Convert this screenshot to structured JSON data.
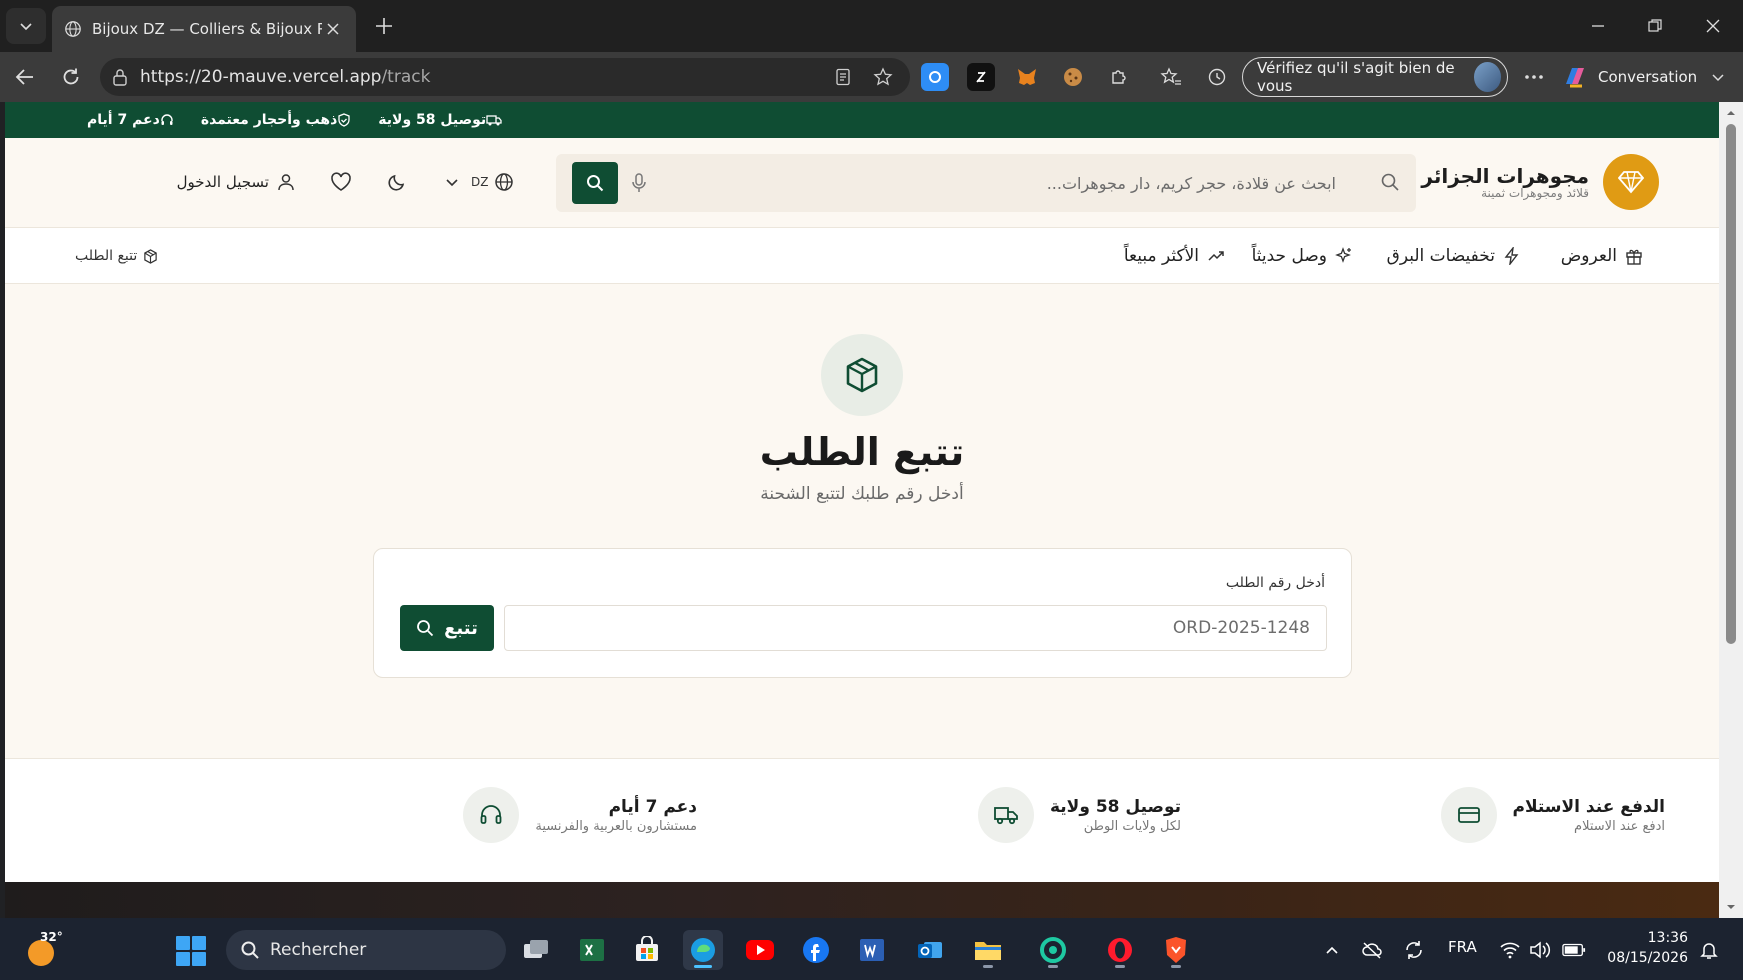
{
  "browser": {
    "tab_title": "Bijoux DZ — Colliers & Bijoux Préc",
    "url_host": "https://20-mauve.vercel.app",
    "url_path": "/track",
    "verify_label": "Vérifiez qu'il s'agit bien de vous",
    "copilot_label": "Conversation"
  },
  "announcement": {
    "items": [
      {
        "label": "توصيل 58 ولاية",
        "icon": "truck-icon"
      },
      {
        "label": "ذهب وأحجار معتمدة",
        "icon": "shield-icon"
      },
      {
        "label": "دعم 7 أيام",
        "icon": "headset-icon"
      }
    ]
  },
  "header": {
    "brand_name": "مجوهرات الجزائر",
    "brand_tagline": "قلائد ومجوهرات ثمينة",
    "search_placeholder": "ابحث عن قلادة، حجر كريم، دار مجوهرات...",
    "region": "DZ",
    "login_label": "تسجيل الدخول"
  },
  "nav": {
    "categories": [
      {
        "label": "العروض",
        "icon": "gift-icon"
      },
      {
        "label": "تخفيضات البرق",
        "icon": "lightning-icon"
      },
      {
        "label": "وصل حديثاً",
        "icon": "sparkle-icon"
      },
      {
        "label": "الأكثر مبيعاً",
        "icon": "trending-icon"
      }
    ],
    "track_label": "تتبع الطلب"
  },
  "tracking": {
    "title": "تتبع الطلب",
    "subtitle": "أدخل رقم طلبك لتتبع الشحنة",
    "field_label": "أدخل رقم الطلب",
    "input_placeholder": "ORD-2025-1248",
    "button_label": "تتبع"
  },
  "features": [
    {
      "title": "الدفع عند الاستلام",
      "desc": "ادفع عند الاستلام",
      "icon": "card-icon"
    },
    {
      "title": "توصيل 58 ولاية",
      "desc": "لكل ولايات الوطن",
      "icon": "truck-icon"
    },
    {
      "title": "دعم 7 أيام",
      "desc": "مستشارون بالعربية والفرنسية",
      "icon": "headset-icon"
    }
  ],
  "taskbar": {
    "temperature": "32°",
    "search_label": "Rechercher",
    "language": "FRA",
    "time": "13:36",
    "date": "08/15/2026"
  },
  "colors": {
    "primary_green": "#0f4d33",
    "gold": "#e09b14",
    "cream": "#fcf8f2"
  }
}
